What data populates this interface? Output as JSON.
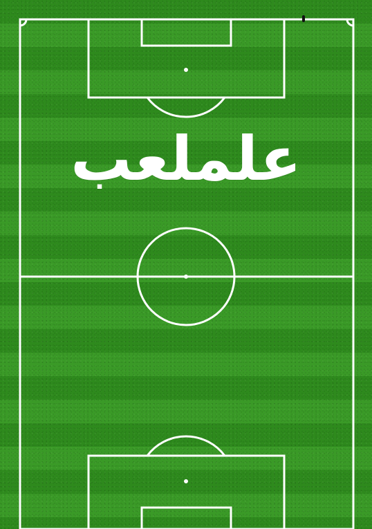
{
  "colors": {
    "grass_light": "#3a9a27",
    "grass_dark": "#2e8a1d",
    "line": "#ffffff",
    "title_text": "#ffffff"
  },
  "title": {
    "text": "علملعب"
  }
}
